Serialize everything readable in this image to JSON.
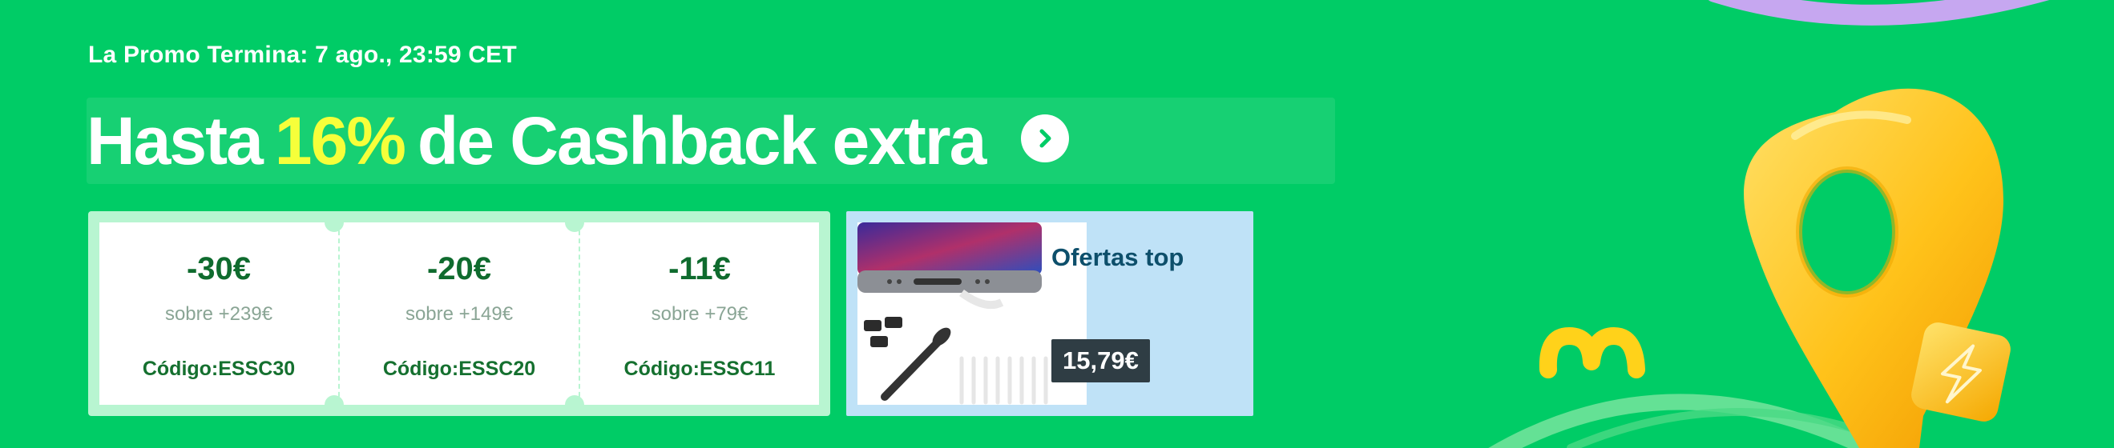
{
  "promo": {
    "ends_text": "La Promo Termina: 7 ago., 23:59 CET"
  },
  "headline": {
    "prefix": "Hasta",
    "highlight": "16%",
    "suffix": "de Cashback extra",
    "highlight_color": "#f6ff3a",
    "arrow_icon": "chevron-right-icon"
  },
  "coupons": [
    {
      "amount": "-30€",
      "condition": "sobre +239€",
      "code": "Código:ESSC30"
    },
    {
      "amount": "-20€",
      "condition": "sobre +149€",
      "code": "Código:ESSC20"
    },
    {
      "amount": "-11€",
      "condition": "sobre +79€",
      "code": "Código:ESSC11"
    }
  ],
  "offer": {
    "title": "Ofertas top",
    "price": "15,79€",
    "image_icon": "phone-accessory-product-image"
  },
  "colors": {
    "background": "#00cc66",
    "coupon_border": "#b8f5d1",
    "coupon_amount": "#0f6b2e",
    "offer_bg": "#bfe2f7",
    "price_bg": "#2f3d44",
    "pin_yellow": "#ffc21a",
    "ring_purple": "#c6a7f0"
  },
  "decorations": {
    "pin_icon": "location-pin-icon",
    "bolt_icon": "lightning-bolt-icon",
    "logo_icon": "m-logo-icon"
  }
}
